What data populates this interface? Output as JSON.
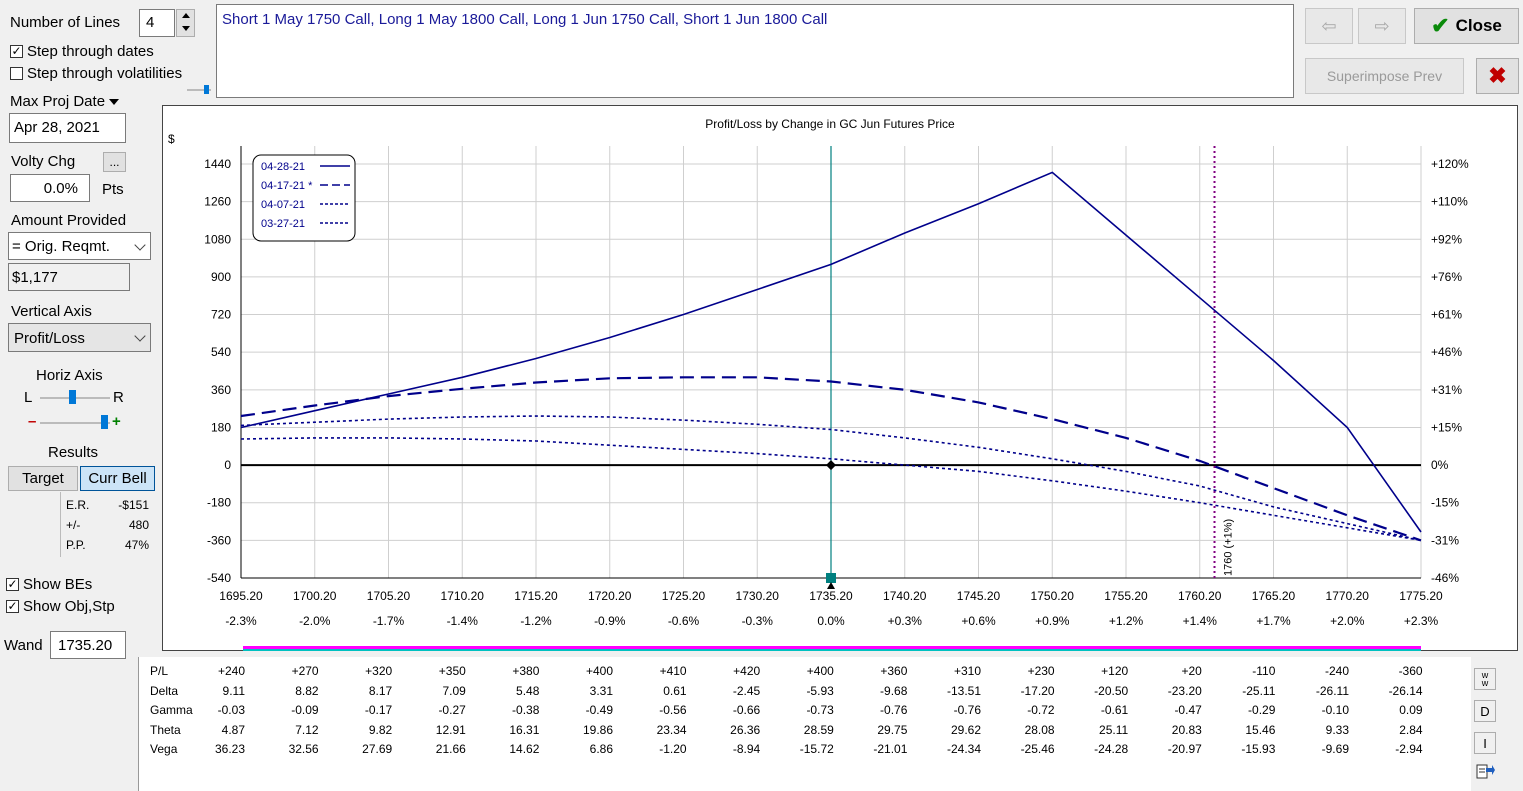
{
  "controls": {
    "number_of_lines_label": "Number of Lines",
    "number_of_lines_value": "4",
    "step_dates_label": "Step through dates",
    "step_dates_checked": true,
    "step_vols_label": "Step through volatilities",
    "step_vols_checked": false,
    "max_proj_date_label": "Max Proj Date",
    "max_proj_date_value": "Apr 28, 2021",
    "volty_chg_label": "Volty Chg",
    "volty_chg_btn": "...",
    "volty_chg_value": "0.0%",
    "volty_unit": "Pts",
    "amount_provided_label": "Amount Provided",
    "amount_provided_value": "= Orig. Reqmt.",
    "amount_value": "$1,177",
    "vertical_axis_label": "Vertical Axis",
    "vertical_axis_value": "Profit/Loss",
    "horiz_axis_label": "Horiz Axis",
    "horiz_l": "L",
    "horiz_r": "R",
    "minus_sign": "–",
    "plus_sign": "+",
    "results_label": "Results",
    "target_btn": "Target",
    "curr_bell_btn": "Curr Bell",
    "er_label": "E.R.",
    "er_value": "-$151",
    "pm_label": "+/-",
    "pm_value": "480",
    "pp_label": "P.P.",
    "pp_value": "47%",
    "show_bes_label": "Show BEs",
    "show_bes_checked": true,
    "show_objstp_label": "Show Obj,Stp",
    "show_objstp_checked": true,
    "wand_label": "Wand",
    "wand_value": "1735.20"
  },
  "header": {
    "position_text": "Short 1 May 1750 Call, Long 1 May 1800 Call, Long 1 Jun 1750 Call, Short 1 Jun 1800 Call",
    "close_label": "Close",
    "superimpose_label": "Superimpose Prev"
  },
  "colors": {
    "series": "#00008b",
    "wand_line": "#008080",
    "marker_line": "#800080",
    "band_magenta": "#ff00ff",
    "band_cyan": "#00c0c0"
  },
  "chart_data": {
    "type": "line",
    "title": "Profit/Loss by Change in GC Jun Futures Price",
    "y_unit_label": "$",
    "ylim": [
      -540,
      1440
    ],
    "xlim": [
      1695.2,
      1775.2
    ],
    "y_ticks": [
      "1440",
      "1260",
      "1080",
      "900",
      "720",
      "540",
      "360",
      "180",
      "0",
      "-180",
      "-360",
      "-540"
    ],
    "y_right_ticks": [
      "+120%",
      "+110%",
      "+92%",
      "+76%",
      "+61%",
      "+46%",
      "+31%",
      "+15%",
      "0%",
      "-15%",
      "-31%",
      "-46%"
    ],
    "x_ticks": [
      "1695.20",
      "1700.20",
      "1705.20",
      "1710.20",
      "1715.20",
      "1720.20",
      "1725.20",
      "1730.20",
      "1735.20",
      "1740.20",
      "1745.20",
      "1750.20",
      "1755.20",
      "1760.20",
      "1765.20",
      "1770.20",
      "1775.20"
    ],
    "x_pct_ticks": [
      "-2.3%",
      "-2.0%",
      "-1.7%",
      "-1.4%",
      "-1.2%",
      "-0.9%",
      "-0.6%",
      "-0.3%",
      "0.0%",
      "+0.3%",
      "+0.6%",
      "+0.9%",
      "+1.2%",
      "+1.4%",
      "+1.7%",
      "+2.0%",
      "+2.3%"
    ],
    "wand_x": 1735.2,
    "marker_x": 1761.2,
    "marker_label": "1760 (+1%)",
    "grid": true,
    "legend_position": "top-left",
    "series": [
      {
        "name": "04-28-21",
        "style": "solid",
        "x": [
          1695.2,
          1700.2,
          1705.2,
          1710.2,
          1715.2,
          1720.2,
          1725.2,
          1730.2,
          1735.2,
          1740.2,
          1745.2,
          1750.2,
          1755.2,
          1760.2,
          1765.2,
          1770.2,
          1775.2
        ],
        "y": [
          180,
          260,
          340,
          420,
          510,
          610,
          720,
          840,
          960,
          1110,
          1250,
          1400,
          1100,
          800,
          500,
          180,
          -320
        ]
      },
      {
        "name": "04-17-21 *",
        "style": "dashed",
        "x": [
          1695.2,
          1700.2,
          1705.2,
          1710.2,
          1715.2,
          1720.2,
          1725.2,
          1730.2,
          1735.2,
          1740.2,
          1745.2,
          1750.2,
          1755.2,
          1760.2,
          1765.2,
          1770.2,
          1775.2
        ],
        "y": [
          235,
          285,
          330,
          365,
          395,
          415,
          420,
          420,
          400,
          360,
          300,
          220,
          130,
          20,
          -110,
          -240,
          -360
        ]
      },
      {
        "name": "04-07-21",
        "style": "dotted",
        "x": [
          1695.2,
          1700.2,
          1705.2,
          1710.2,
          1715.2,
          1720.2,
          1725.2,
          1730.2,
          1735.2,
          1740.2,
          1745.2,
          1750.2,
          1755.2,
          1760.2,
          1765.2,
          1770.2,
          1775.2
        ],
        "y": [
          190,
          205,
          220,
          230,
          235,
          230,
          215,
          195,
          170,
          130,
          85,
          30,
          -30,
          -100,
          -200,
          -280,
          -360
        ]
      },
      {
        "name": "03-27-21",
        "style": "dotted",
        "x": [
          1695.2,
          1700.2,
          1705.2,
          1710.2,
          1715.2,
          1720.2,
          1725.2,
          1730.2,
          1735.2,
          1740.2,
          1745.2,
          1750.2,
          1755.2,
          1760.2,
          1765.2,
          1770.2,
          1775.2
        ],
        "y": [
          125,
          130,
          130,
          125,
          115,
          95,
          75,
          55,
          30,
          0,
          -30,
          -75,
          -125,
          -180,
          -240,
          -300,
          -360
        ]
      }
    ]
  },
  "table": {
    "row_labels": [
      "P/L",
      "Delta",
      "Gamma",
      "Theta",
      "Vega"
    ],
    "rows": [
      [
        "+240",
        "+270",
        "+320",
        "+350",
        "+380",
        "+400",
        "+410",
        "+420",
        "+400",
        "+360",
        "+310",
        "+230",
        "+120",
        "+20",
        "-110",
        "-240",
        "-360"
      ],
      [
        "9.11",
        "8.82",
        "8.17",
        "7.09",
        "5.48",
        "3.31",
        "0.61",
        "-2.45",
        "-5.93",
        "-9.68",
        "-13.51",
        "-17.20",
        "-20.50",
        "-23.20",
        "-25.11",
        "-26.11",
        "-26.14"
      ],
      [
        "-0.03",
        "-0.09",
        "-0.17",
        "-0.27",
        "-0.38",
        "-0.49",
        "-0.56",
        "-0.66",
        "-0.73",
        "-0.76",
        "-0.76",
        "-0.72",
        "-0.61",
        "-0.47",
        "-0.29",
        "-0.10",
        "0.09"
      ],
      [
        "4.87",
        "7.12",
        "9.82",
        "12.91",
        "16.31",
        "19.86",
        "23.34",
        "26.36",
        "28.59",
        "29.75",
        "29.62",
        "28.08",
        "25.11",
        "20.83",
        "15.46",
        "9.33",
        "2.84"
      ],
      [
        "36.23",
        "32.56",
        "27.69",
        "21.66",
        "14.62",
        "6.86",
        "-1.20",
        "-8.94",
        "-15.72",
        "-21.01",
        "-24.34",
        "-25.46",
        "-24.28",
        "-20.97",
        "-15.93",
        "-9.69",
        "-2.94"
      ]
    ]
  },
  "side_tools": {
    "w_btn": "w",
    "d_btn": "D",
    "i_btn": "I"
  }
}
